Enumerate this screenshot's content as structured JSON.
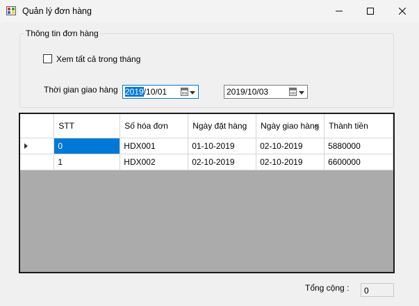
{
  "window": {
    "title": "Quản lý đơn hàng"
  },
  "group": {
    "title": "Thông tin đơn hàng",
    "checkbox_label": "Xem tất cả trong tháng",
    "checkbox_checked": false,
    "time_label": "Thời gian giao hàng",
    "date_from_selected": "2019",
    "date_from_rest": "/10/01",
    "date_to": "2019/10/03"
  },
  "grid": {
    "headers": [
      "STT",
      "Số hóa đơn",
      "Ngày đặt hàng",
      "Ngày giao hàng",
      "Thành tiền"
    ],
    "sorted_column": "Ngày giao hàng",
    "current_row": 0,
    "rows": [
      [
        "0",
        "HDX001",
        "01-10-2019",
        "02-10-2019",
        "5880000"
      ],
      [
        "1",
        "HDX002",
        "02-10-2019",
        "02-10-2019",
        "6600000"
      ]
    ]
  },
  "footer": {
    "total_label": "Tổng cộng :",
    "total_value": "0"
  }
}
